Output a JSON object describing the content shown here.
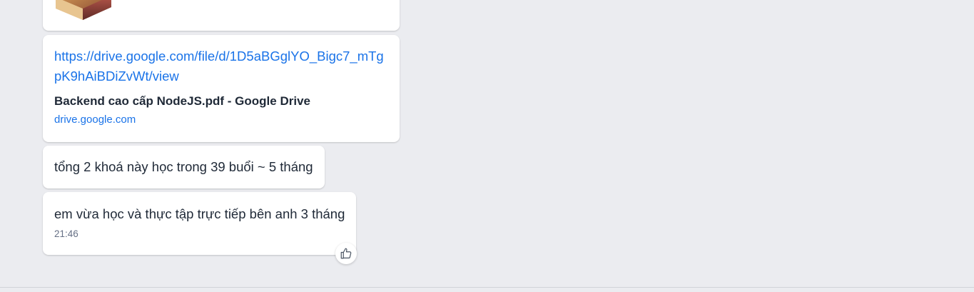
{
  "messages": {
    "image_attachment": {
      "icon": "winrar-archive-icon"
    },
    "link_preview": {
      "url": "https://drive.google.com/file/d/1D5aBGglYO_Bigc7_mTgpK9hAiBDiZvWt/view",
      "title": "Backend cao cấp NodeJS.pdf - Google Drive",
      "domain": "drive.google.com"
    },
    "text_1": "tổng 2 khoá này học trong 39 buổi ~ 5 tháng",
    "text_2": "em vừa học và thực tập trực tiếp bên anh 3 tháng",
    "text_2_time": "21:46"
  },
  "reaction": {
    "icon": "thumbs-up-icon"
  },
  "colors": {
    "background": "#ebecf0",
    "bubble": "#ffffff",
    "link": "#1a73e8",
    "text": "#1f2937",
    "timestamp": "#667085"
  }
}
